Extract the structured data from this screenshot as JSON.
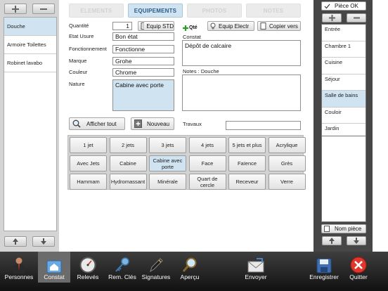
{
  "left_list": {
    "items": [
      "Douche",
      "Armoire Toilettes",
      "Robinet lavabo"
    ]
  },
  "tabs": [
    "ELEMENTS",
    "EQUIPEMENTS",
    "PHOTOS",
    "NOTES"
  ],
  "form": {
    "quantite_label": "Quantité",
    "quantite_value": "1",
    "etat_label": "Etat Usure",
    "etat_value": "Bon état",
    "fonctionnement_label": "Fonctionnement",
    "fonctionnement_value": "Fonctionne",
    "marque_label": "Marque",
    "marque_value": "Grohe",
    "couleur_label": "Couleur",
    "couleur_value": "Chrome",
    "nature_label": "Nature",
    "nature_value": "Cabine avec porte",
    "constat_label": "Constat",
    "constat_value": "Dépôt de calcaire",
    "notes_label": "Notes : Douche",
    "notes_value": "",
    "travaux_label": "Travaux",
    "travaux_value": ""
  },
  "buttons": {
    "equip_std": "Equip STD",
    "qte": "Qté",
    "equip_electr": "Equip Electr",
    "copier_vers": "Copier vers",
    "afficher_tout": "Afficher tout",
    "nouveau": "Nouveau"
  },
  "nature_options": [
    [
      "1 jet",
      "2 jets",
      "3 jets",
      "4 jets",
      "5 jets et plus",
      "Acrylique"
    ],
    [
      "Avec Jets",
      "Cabine",
      "Cabine avec porte",
      "Face",
      "Faïence",
      "Grès"
    ],
    [
      "Hammam",
      "Hydromassant",
      "Minérale",
      "Quart de cercle",
      "Receveur",
      "Verre"
    ]
  ],
  "selected_option": "Cabine avec porte",
  "right_panel": {
    "piece_ok": "Pièce OK",
    "rooms": [
      "Entrée",
      "Chambre 1",
      "Cuisine",
      "Séjour",
      "Salle de bains",
      "Couloir",
      "Jardin"
    ],
    "selected_room": "Salle de bains",
    "nom_piece": "Nom pièce"
  },
  "toolbar": {
    "items": [
      "Personnes",
      "Constat",
      "Relevés",
      "Rem. Clés",
      "Signatures",
      "Aperçu",
      "Envoyer",
      "Enregistrer",
      "Quitter"
    ],
    "active": "Constat"
  },
  "colors": {
    "selection": "#cfe3f0",
    "toolbar_bg": "#1e1e1e",
    "quit_red": "#e0362c"
  }
}
